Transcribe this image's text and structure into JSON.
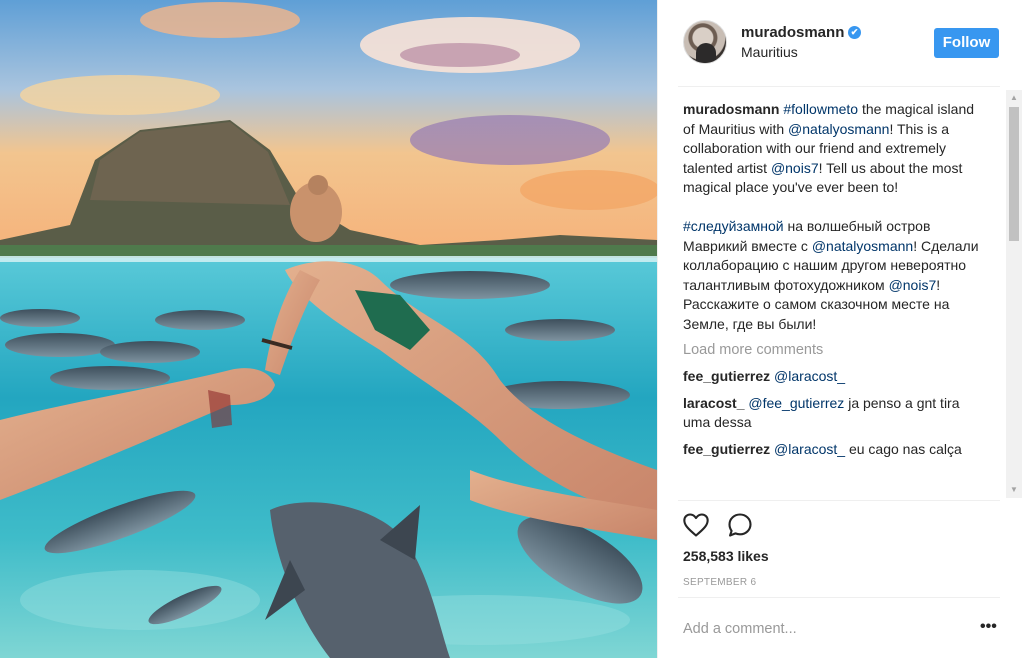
{
  "header": {
    "username": "muradosmann",
    "location": "Mauritius",
    "follow_label": "Follow",
    "verified_icon": "✔"
  },
  "caption": {
    "username": "muradosmann",
    "en": {
      "hashtag": "#followmeto",
      "text1": " the magical island of Mauritius with ",
      "mention1": "@natalyosmann",
      "text2": "! This is a collaboration with our friend and extremely talented artist ",
      "mention2": "@nois7",
      "text3": "! Tell us about the most magical place you've ever been to!"
    },
    "ru": {
      "hashtag": "#следуйзамной",
      "text1": " на волшебный остров Маврикий вместе с ",
      "mention1": "@natalyosmann",
      "text2": "! Сделали коллаборацию с нашим другом невероятно талантливым фотохудожником ",
      "mention2": "@nois7",
      "text3": "! Расскажите о самом сказочном месте на Земле, где вы были!"
    }
  },
  "load_more_label": "Load more comments",
  "comments": [
    {
      "username": "fee_gutierrez",
      "mention": "@laracost_",
      "text": ""
    },
    {
      "username": "laracost_",
      "mention": "@fee_gutierrez",
      "text": " ja penso a gnt tira uma dessa"
    },
    {
      "username": "fee_gutierrez",
      "mention": "@laracost_",
      "text": " eu cago nas calça"
    }
  ],
  "likes": "258,583 likes",
  "date": "SEPTEMBER 6",
  "add_comment_placeholder": "Add a comment...",
  "more_icon": "•••",
  "scrollbar": {
    "up": "▲",
    "down": "▼"
  },
  "colors": {
    "accent": "#3897f0",
    "link": "#003569",
    "muted": "#999999"
  }
}
